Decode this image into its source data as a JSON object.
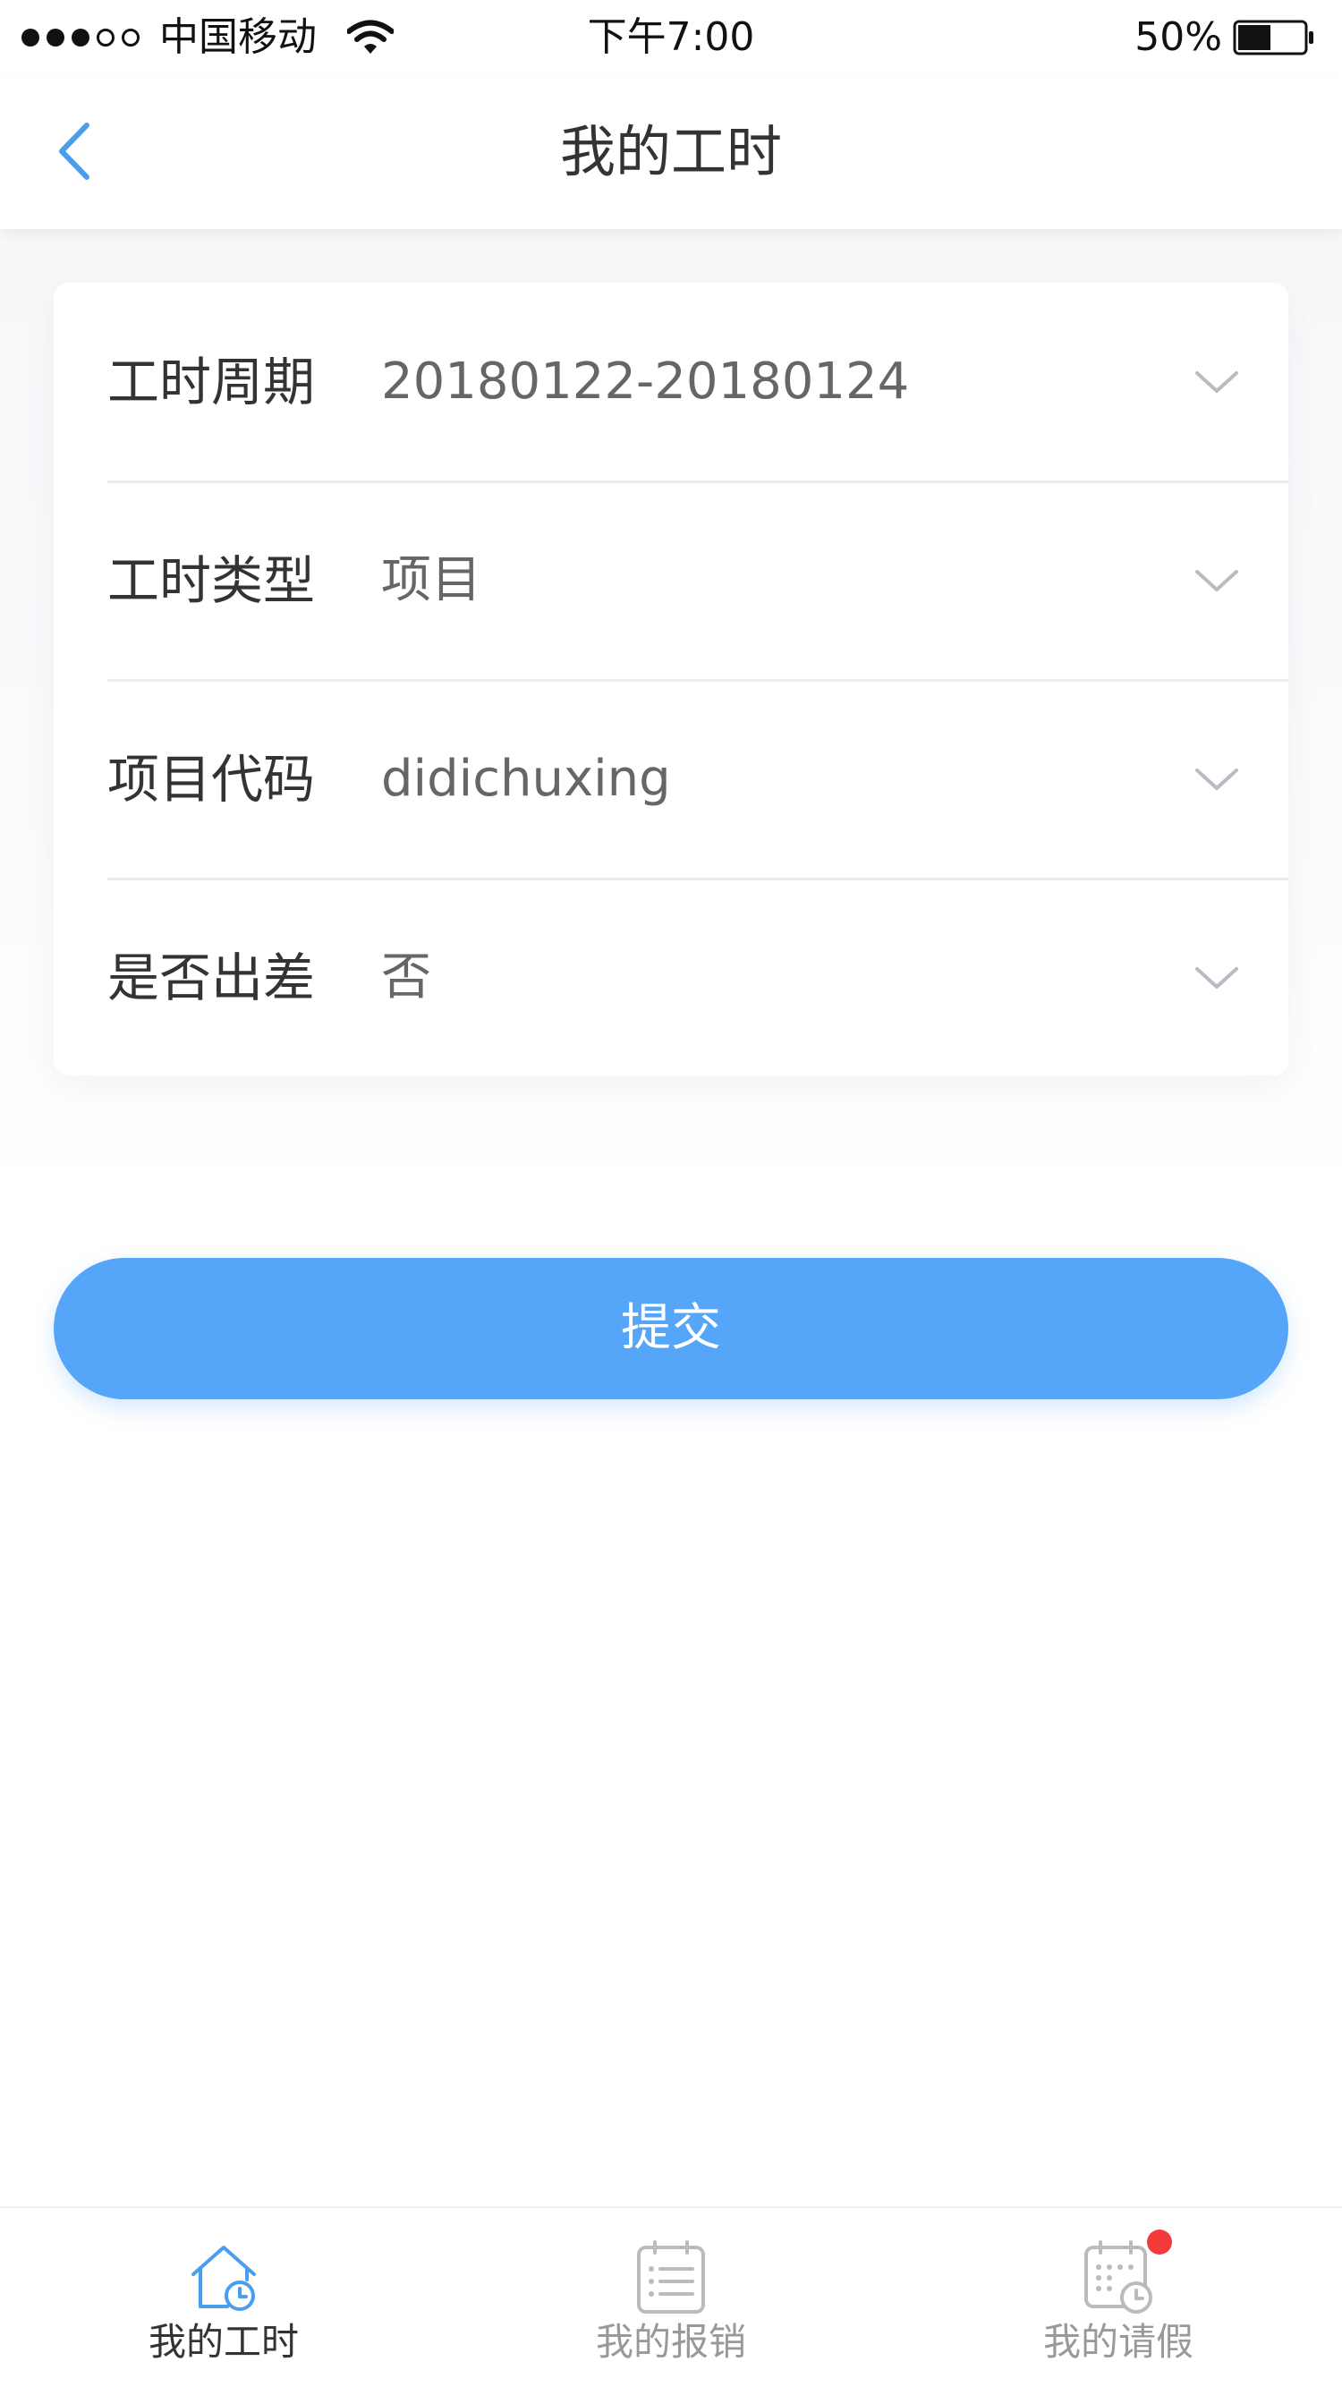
{
  "status_bar": {
    "carrier": "中国移动",
    "time": "下午7:00",
    "battery": "50%",
    "battery_level": 0.5,
    "signal_strength": 3,
    "signal_max": 5
  },
  "nav": {
    "title": "我的工时",
    "back_icon": "chevron-left-icon"
  },
  "form": {
    "rows": [
      {
        "label": "工时周期",
        "value": "20180122-20180124"
      },
      {
        "label": "工时类型",
        "value": "项目"
      },
      {
        "label": "项目代码",
        "value": "didichuxing"
      },
      {
        "label": "是否出差",
        "value": "否"
      }
    ]
  },
  "submit_label": "提交",
  "tabs": [
    {
      "label": "我的工时",
      "icon": "home-clock-icon",
      "active": true
    },
    {
      "label": "我的报销",
      "icon": "list-icon",
      "active": false
    },
    {
      "label": "我的请假",
      "icon": "calendar-clock-icon",
      "active": false,
      "badge": true
    }
  ],
  "colors": {
    "accent": "#55a6f8",
    "badge": "#f23a3a"
  }
}
